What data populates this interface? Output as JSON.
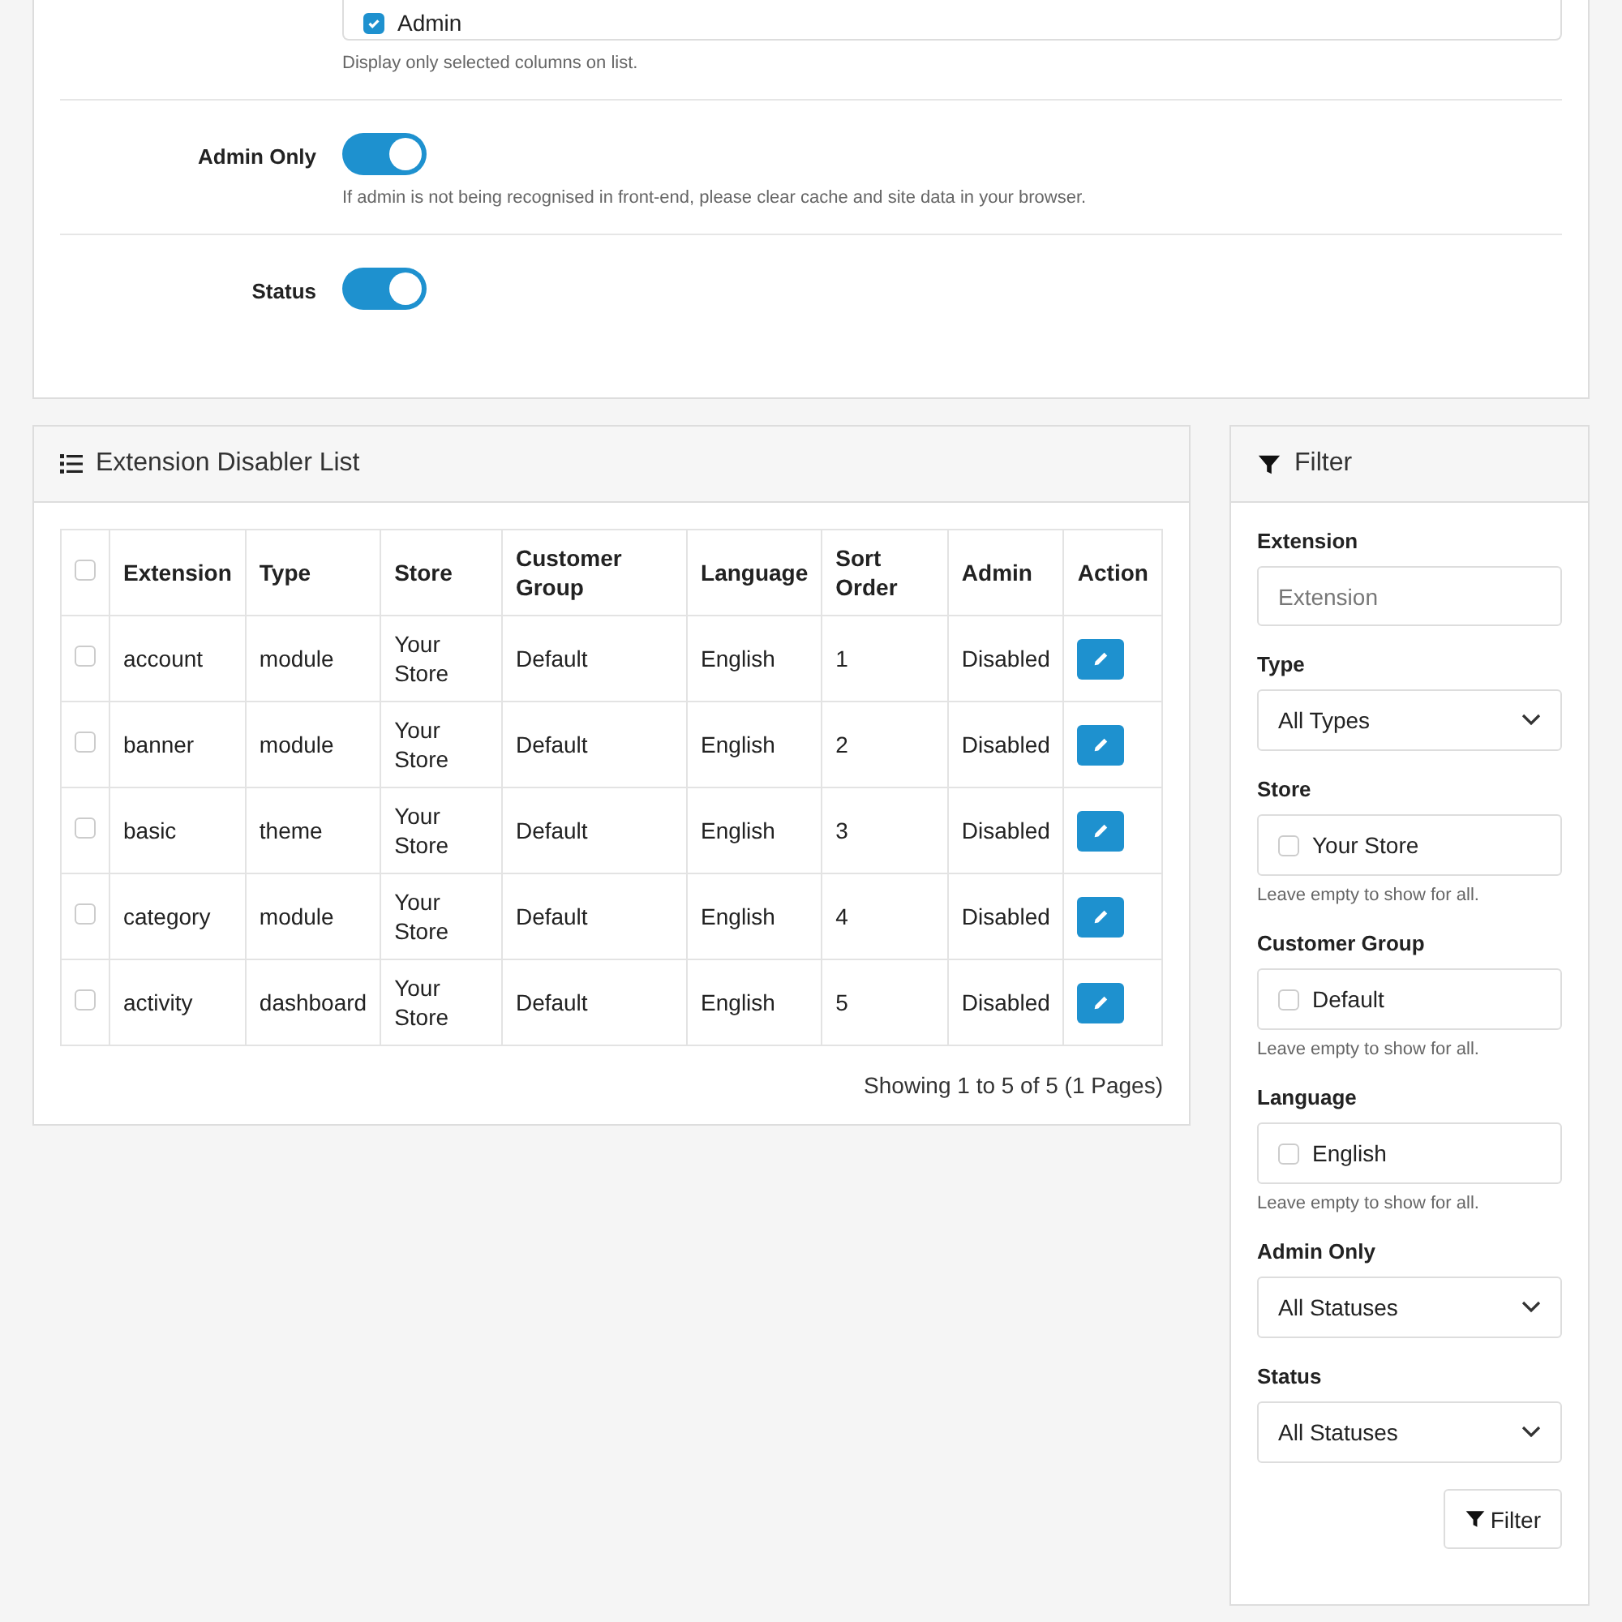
{
  "settings": {
    "columns": [
      {
        "label": "Admin",
        "checked": true
      }
    ],
    "columns_help": "Display only selected columns on list.",
    "admin_only": {
      "label": "Admin Only",
      "on": true,
      "help": "If admin is not being recognised in front-end, please clear cache and site data in your browser."
    },
    "status": {
      "label": "Status",
      "on": true
    }
  },
  "list": {
    "title": "Extension Disabler List",
    "select_all": {
      "checked": false
    },
    "columns": [
      "Extension",
      "Type",
      "Store",
      "Customer Group",
      "Language",
      "Sort Order",
      "Admin",
      "Action"
    ],
    "rows": [
      {
        "selected": false,
        "cells": [
          "account",
          "module",
          "Your Store",
          "Default",
          "English",
          "1",
          "Disabled"
        ]
      },
      {
        "selected": false,
        "cells": [
          "banner",
          "module",
          "Your Store",
          "Default",
          "English",
          "2",
          "Disabled"
        ]
      },
      {
        "selected": false,
        "cells": [
          "basic",
          "theme",
          "Your Store",
          "Default",
          "English",
          "3",
          "Disabled"
        ]
      },
      {
        "selected": false,
        "cells": [
          "category",
          "module",
          "Your Store",
          "Default",
          "English",
          "4",
          "Disabled"
        ]
      },
      {
        "selected": false,
        "cells": [
          "activity",
          "dashboard",
          "Your Store",
          "Default",
          "English",
          "5",
          "Disabled"
        ]
      }
    ],
    "summary": "Showing 1 to 5 of 5 (1 Pages)"
  },
  "filter": {
    "title": "Filter",
    "fields": [
      {
        "kind": "text",
        "label": "Extension",
        "placeholder": "Extension"
      },
      {
        "kind": "select",
        "label": "Type",
        "value": "All Types"
      },
      {
        "kind": "checklist",
        "label": "Store",
        "options": [
          {
            "label": "Your Store",
            "checked": false
          }
        ],
        "help": "Leave empty to show for all."
      },
      {
        "kind": "checklist",
        "label": "Customer Group",
        "options": [
          {
            "label": "Default",
            "checked": false
          }
        ],
        "help": "Leave empty to show for all."
      },
      {
        "kind": "checklist",
        "label": "Language",
        "options": [
          {
            "label": "English",
            "checked": false
          }
        ],
        "help": "Leave empty to show for all."
      },
      {
        "kind": "select",
        "label": "Admin Only",
        "value": "All Statuses"
      },
      {
        "kind": "select",
        "label": "Status",
        "value": "All Statuses"
      }
    ],
    "button": "Filter"
  }
}
